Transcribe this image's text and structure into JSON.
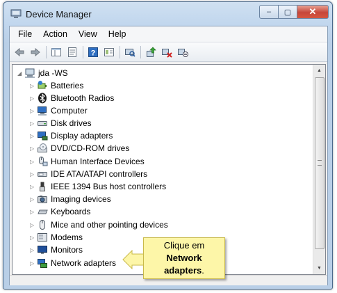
{
  "window": {
    "title": "Device Manager",
    "icon": "device-manager-icon"
  },
  "caption": {
    "minimize": "–",
    "maximize": "▢",
    "close": "✕"
  },
  "menu": [
    "File",
    "Action",
    "View",
    "Help"
  ],
  "toolbar": [
    "back-icon",
    "forward-icon",
    "console-tree-icon",
    "properties-icon",
    "help-icon",
    "view-icon",
    "scan-hardware-icon",
    "update-driver-icon",
    "uninstall-icon",
    "disable-icon"
  ],
  "tree": {
    "root": "jda -WS",
    "items": [
      {
        "label": "Batteries",
        "icon": "battery-icon"
      },
      {
        "label": "Bluetooth Radios",
        "icon": "bluetooth-icon"
      },
      {
        "label": "Computer",
        "icon": "computer-icon"
      },
      {
        "label": "Disk drives",
        "icon": "disk-drive-icon"
      },
      {
        "label": "Display adapters",
        "icon": "display-adapter-icon"
      },
      {
        "label": "DVD/CD-ROM drives",
        "icon": "dvd-icon"
      },
      {
        "label": "Human Interface Devices",
        "icon": "hid-icon"
      },
      {
        "label": "IDE ATA/ATAPI controllers",
        "icon": "ide-controller-icon"
      },
      {
        "label": "IEEE 1394 Bus host controllers",
        "icon": "firewire-icon"
      },
      {
        "label": "Imaging devices",
        "icon": "camera-icon"
      },
      {
        "label": "Keyboards",
        "icon": "keyboard-icon"
      },
      {
        "label": "Mice and other pointing devices",
        "icon": "mouse-icon"
      },
      {
        "label": "Modems",
        "icon": "modem-icon"
      },
      {
        "label": "Monitors",
        "icon": "monitor-icon"
      },
      {
        "label": "Network adapters",
        "icon": "network-adapter-icon"
      }
    ]
  },
  "callout": {
    "line1": "Clique em",
    "line2": "Network",
    "line3": "adapters",
    "line3_suffix": "."
  }
}
